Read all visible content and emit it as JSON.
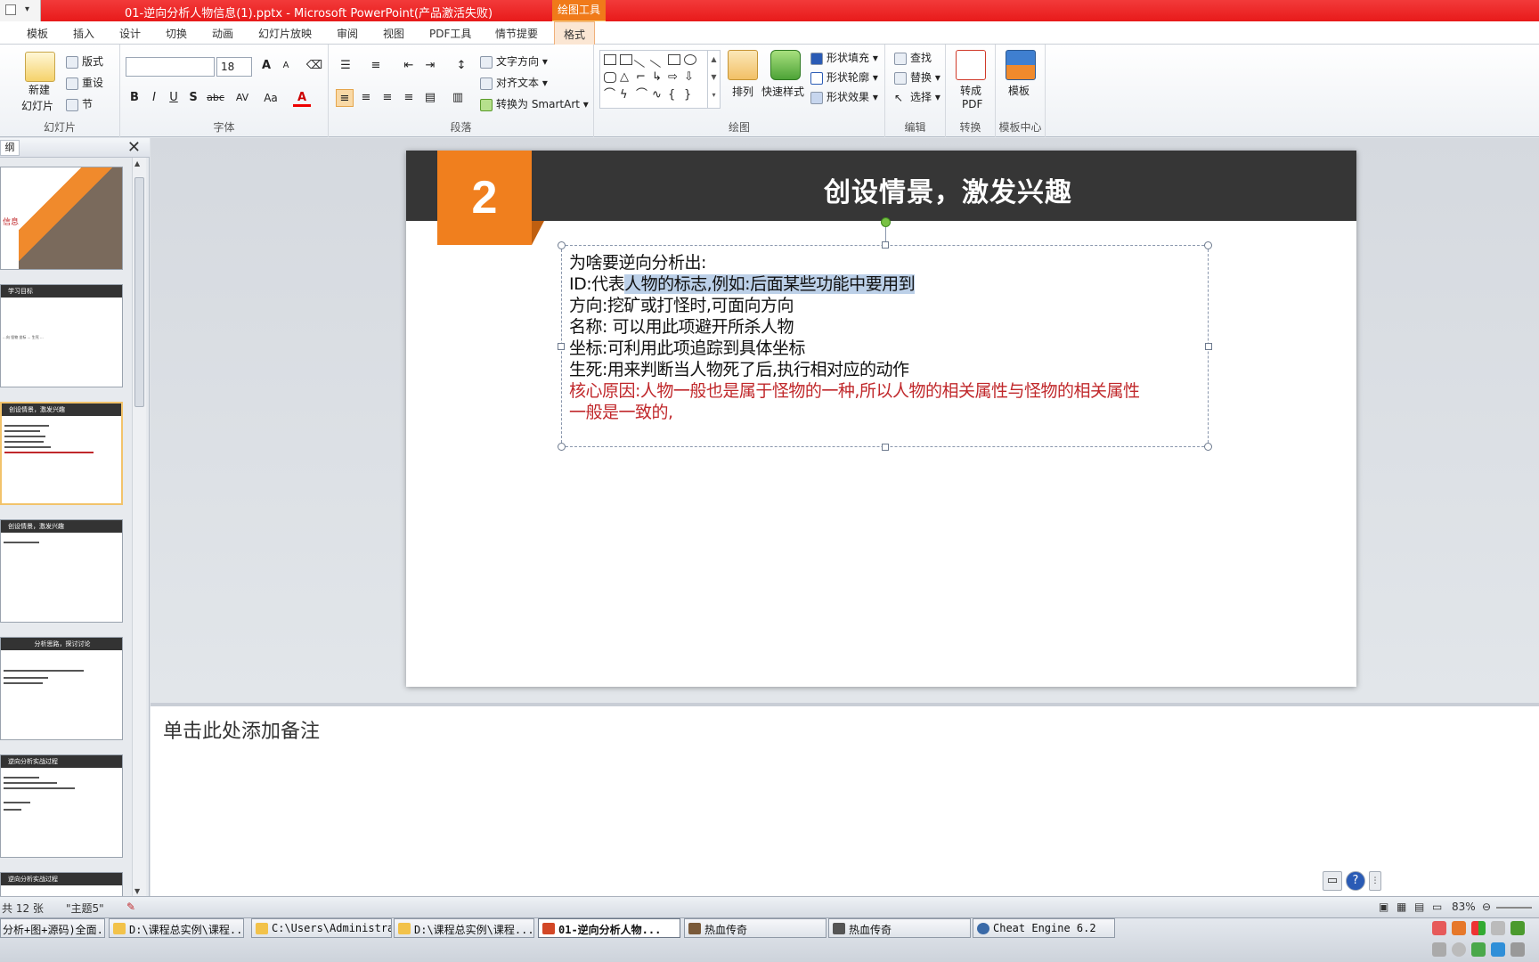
{
  "window": {
    "title": "01-逆向分析人物信息(1).pptx  -  Microsoft PowerPoint(产品激活失败)",
    "contextual_tab_group": "绘图工具"
  },
  "ribbon_tabs": [
    "模板",
    "插入",
    "设计",
    "切换",
    "动画",
    "幻灯片放映",
    "审阅",
    "视图",
    "PDF工具",
    "情节提要",
    "格式"
  ],
  "ribbon": {
    "slides_group": {
      "label": "幻灯片",
      "new_slide": "新建\n幻灯片",
      "new_slide_line1": "新建",
      "new_slide_line2": "幻灯片",
      "layout": "版式",
      "reset": "重设",
      "section": "节"
    },
    "font_group": {
      "label": "字体",
      "font_name": "",
      "font_size": "18",
      "bold": "B",
      "italic": "I",
      "underline": "U",
      "shadow": "S",
      "strike": "abc",
      "spacing": "AV",
      "case": "Aa",
      "font_color": "A",
      "grow": "A",
      "shrink": "A"
    },
    "paragraph_group": {
      "label": "段落",
      "text_direction": "文字方向",
      "align_text": "对齐文本",
      "smartart": "转换为 SmartArt"
    },
    "drawing_group": {
      "label": "绘图",
      "arrange": "排列",
      "quick_styles": "快速样式",
      "shape_fill": "形状填充",
      "shape_outline": "形状轮廓",
      "shape_effects": "形状效果"
    },
    "editing_group": {
      "label": "编辑",
      "find": "查找",
      "replace": "替换",
      "select": "选择"
    },
    "convert_group": {
      "label": "转换",
      "to_pdf_line1": "转成",
      "to_pdf_line2": "PDF"
    },
    "template_group": {
      "label": "模板中心",
      "template": "模板"
    }
  },
  "left_pane": {
    "tab": "纲",
    "slides": [
      {
        "band": "",
        "extra": "信息"
      },
      {
        "band": "学习目标",
        "body": "...向 怪物 坐标 ... 生死 ..."
      },
      {
        "band": "创设情景，激发兴趣",
        "body": ""
      },
      {
        "band": "创设情景，激发兴趣",
        "body": ""
      },
      {
        "band": "分析思路，探讨讨论",
        "body": ""
      },
      {
        "band": "逆向分析实战过程",
        "body": ""
      },
      {
        "band": "逆向分析实战过程",
        "body": ""
      }
    ]
  },
  "slide": {
    "number": "2",
    "title": "创设情景，激发兴趣",
    "lines": [
      {
        "text": "为啥要逆向分析出:",
        "color": "black"
      },
      {
        "pre": "ID:代表",
        "sel": "人物的标志,例如:后面某些功能中要用到",
        "color": "black"
      },
      {
        "text": "方向:挖矿或打怪时,可面向方向",
        "color": "black"
      },
      {
        "text": "名称: 可以用此项避开所杀人物",
        "color": "black"
      },
      {
        "text": "坐标:可利用此项追踪到具体坐标",
        "color": "black"
      },
      {
        "text": "生死:用来判断当人物死了后,执行相对应的动作",
        "color": "black"
      },
      {
        "text": "核心原因:人物一般也是属于怪物的一种,所以人物的相关属性与怪物的相关属性",
        "color": "red"
      },
      {
        "text": "一般是一致的,",
        "color": "red"
      }
    ],
    "red_color": "#c0282b",
    "accent_color": "#f07f1e"
  },
  "notes": {
    "placeholder": "单击此处添加备注"
  },
  "status_bar": {
    "slide_count": "共 12 张",
    "theme": "\"主题5\"",
    "zoom": "83%"
  },
  "taskbar": {
    "items": [
      {
        "label": "分析+图+源码)全面...",
        "icon": "folder"
      },
      {
        "label": "D:\\课程总实例\\课程...",
        "icon": "folder"
      },
      {
        "label": "C:\\Users\\Administra...",
        "icon": "folder"
      },
      {
        "label": "D:\\课程总实例\\课程...",
        "icon": "folder"
      },
      {
        "label": "01-逆向分析人物...",
        "icon": "powerpoint",
        "active": true
      },
      {
        "label": "热血传奇",
        "icon": "game"
      },
      {
        "label": "热血传奇",
        "icon": "game"
      },
      {
        "label": "Cheat Engine 6.2",
        "icon": "cheat-engine"
      }
    ]
  }
}
